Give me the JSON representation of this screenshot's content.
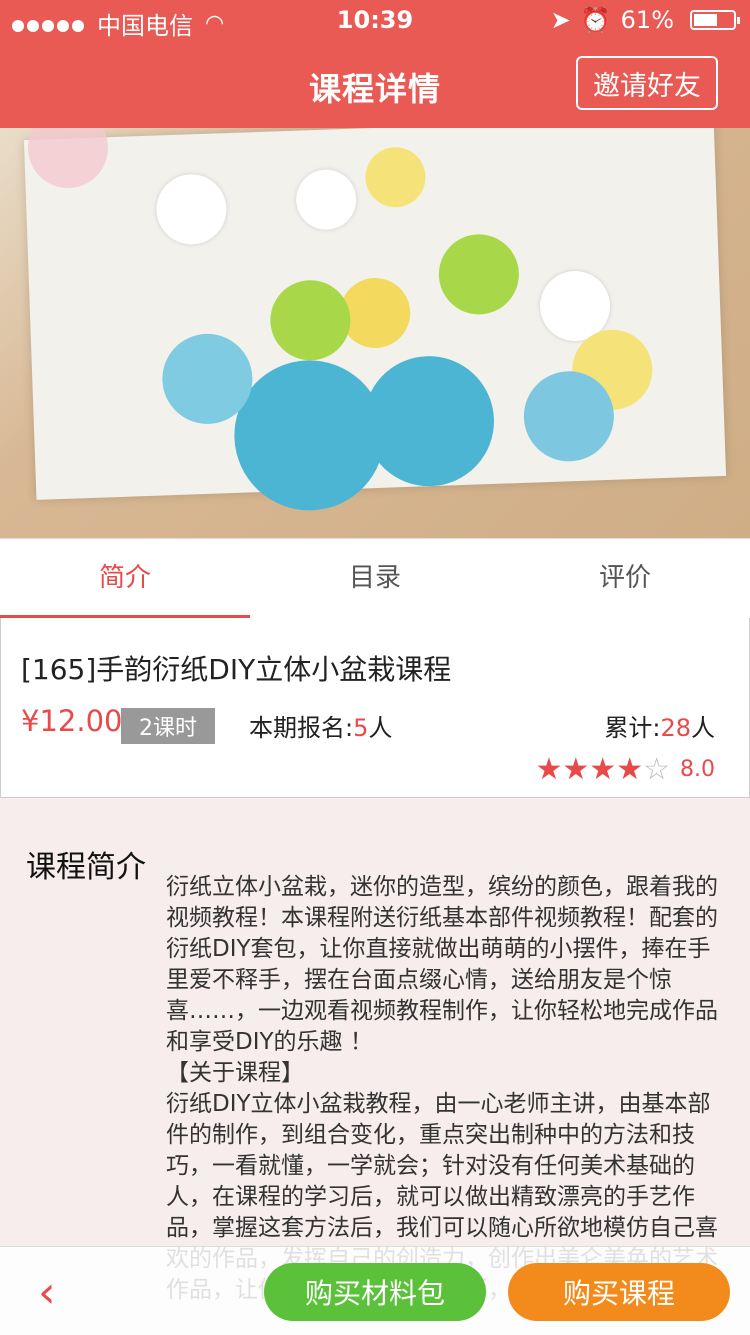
{
  "status_bar": {
    "carrier": "中国电信",
    "time": "10:39",
    "battery": "61%",
    "battery_level": 0.61
  },
  "nav": {
    "title": "课程详情",
    "invite_label": "邀请好友"
  },
  "banner": {
    "slide_count": 5,
    "active_slide": 1
  },
  "tabs": [
    {
      "label": "简介"
    },
    {
      "label": "目录"
    },
    {
      "label": "评价"
    }
  ],
  "course": {
    "title": "[165]手韵衍纸DIY立体小盆栽课程",
    "price": "¥12.00",
    "lessons": "2课时",
    "enroll_label": "本期报名:",
    "enroll_count": "5",
    "person_unit": "人",
    "total_label": "累计:",
    "total_count": "28",
    "rating": "8.0",
    "stars_filled": 4,
    "stars_total": 5
  },
  "intro": {
    "label": "课程简介",
    "text": "衍纸立体小盆栽，迷你的造型，缤纷的颜色，跟着我的视频教程！本课程附送衍纸基本部件视频教程！配套的衍纸DIY套包，让你直接就做出萌萌的小摆件，捧在手里爱不释手，摆在台面点缀心情，送给朋友是个惊喜……，一边观看视频教程制作，让你轻松地完成作品和享受DIY的乐趣 ！\n【关于课程】\n衍纸DIY立体小盆栽教程，由一心老师主讲，由基本部件的制作，到组合变化，重点突出制种中的方法和技巧，一看就懂，一学就会；针对没有任何美术基础的人，在课程的学习后，就可以做出精致漂亮的手艺作品，掌握这套方法后，我们可以随心所欲地模仿自己喜欢的作品，发挥自己的创造力，创作出美仑美奂的艺术作品，让你的生活更加丰富多彩，也让你收获满满！"
  },
  "bottom": {
    "back_icon": "‹",
    "buy_material_label": "购买材料包",
    "buy_course_label": "购买课程"
  }
}
